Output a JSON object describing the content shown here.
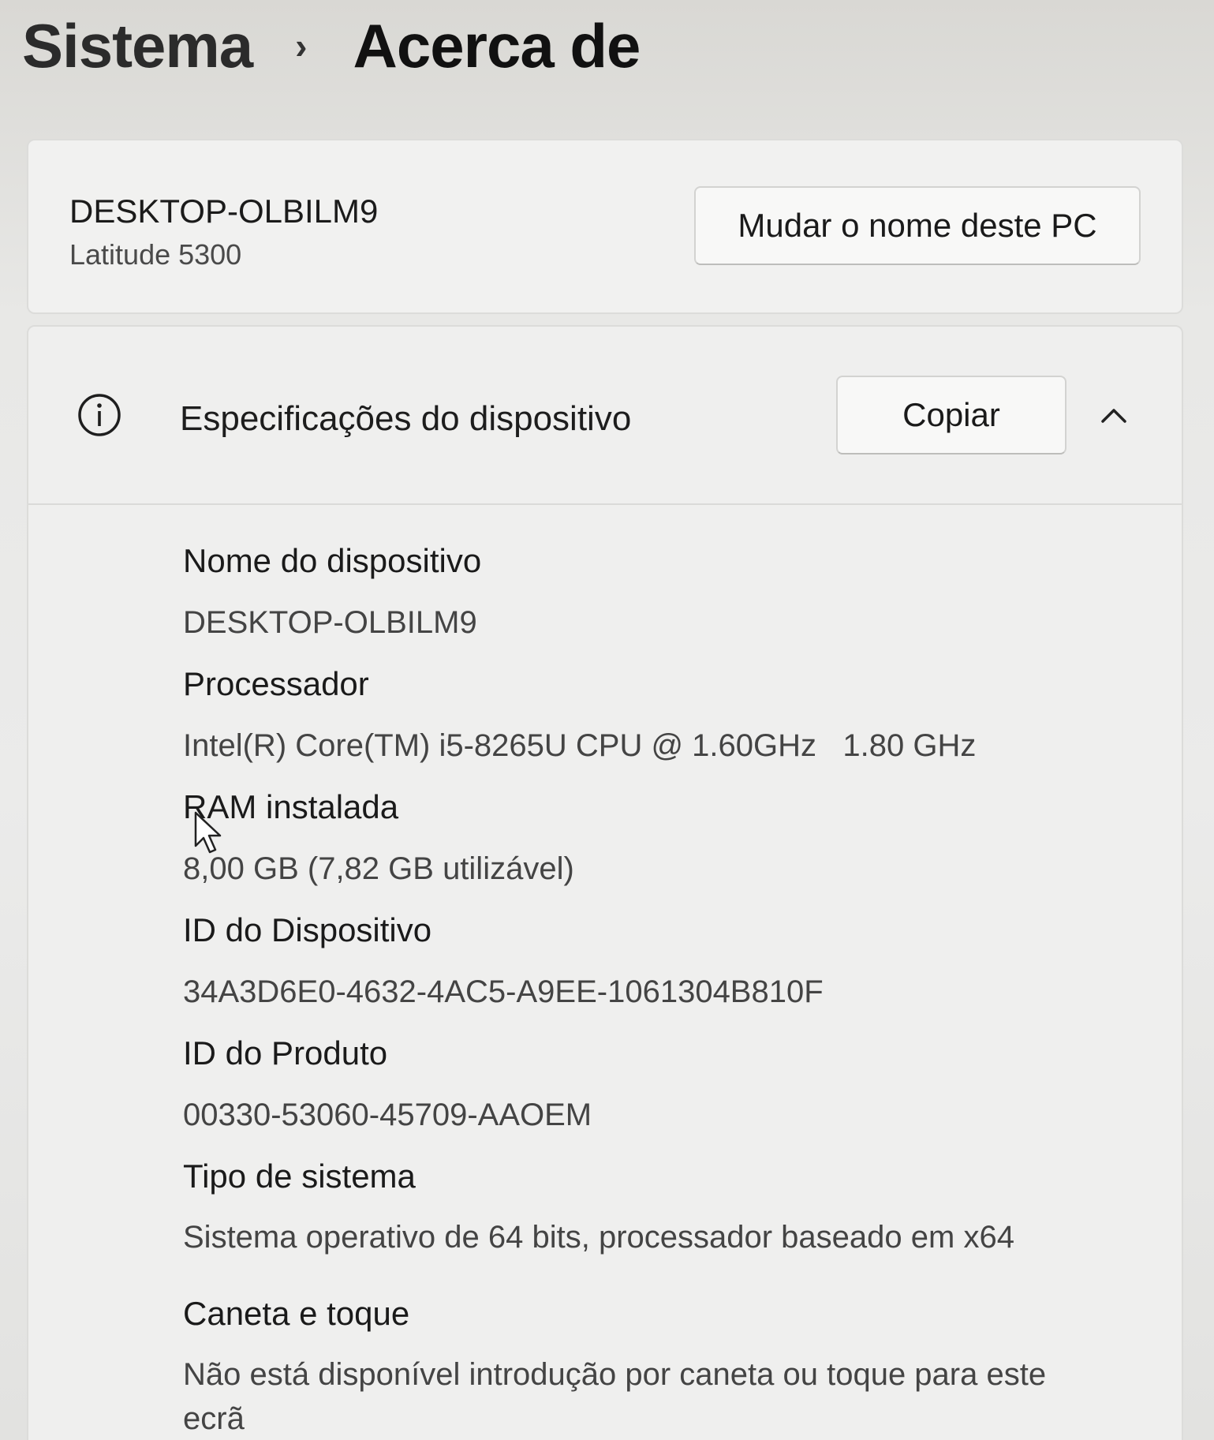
{
  "breadcrumb": {
    "root": "Sistema",
    "separator": "›",
    "current": "Acerca de"
  },
  "pc_card": {
    "device_name": "DESKTOP-OLBILM9",
    "model": "Latitude 5300",
    "rename_button": "Mudar o nome deste PC"
  },
  "specs": {
    "icon": "info-icon",
    "title": "Especificações do dispositivo",
    "copy_button": "Copiar",
    "expand_icon": "chevron-up-icon",
    "items": [
      {
        "label": "Nome do dispositivo",
        "value": "DESKTOP-OLBILM9"
      },
      {
        "label": "Processador",
        "value": "Intel(R) Core(TM) i5-8265U CPU @ 1.60GHz   1.80 GHz"
      },
      {
        "label": "RAM instalada",
        "value": "8,00 GB (7,82 GB utilizável)"
      },
      {
        "label": "ID do Dispositivo",
        "value": "34A3D6E0-4632-4AC5-A9EE-1061304B810F"
      },
      {
        "label": "ID do Produto",
        "value": "00330-53060-45709-AAOEM"
      },
      {
        "label": "Tipo de sistema",
        "value": "Sistema operativo de 64 bits, processador baseado em x64"
      },
      {
        "label": "Caneta e toque",
        "value": "Não está disponível introdução por caneta ou toque para este ecrã"
      }
    ]
  },
  "cursor_icon": "mouse-pointer-icon"
}
